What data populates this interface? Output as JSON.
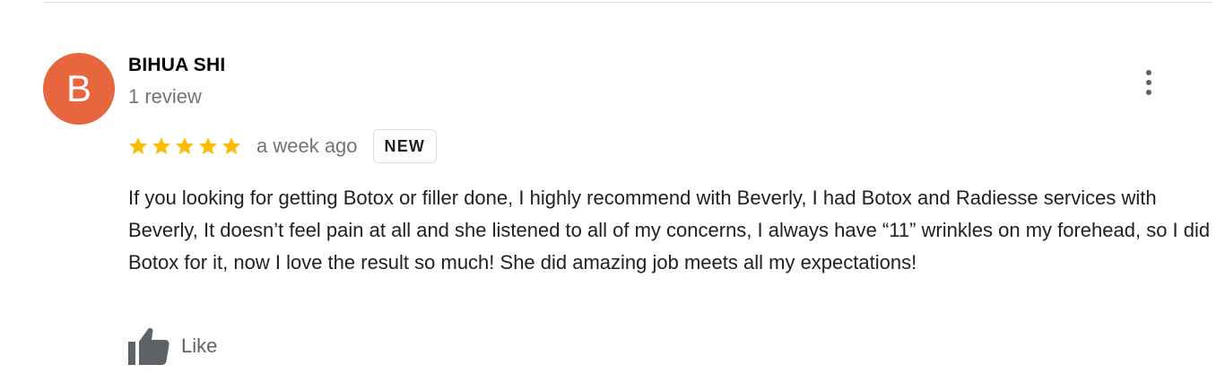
{
  "review": {
    "avatar_letter": "B",
    "author_name": "BIHUA SHI",
    "review_count": "1 review",
    "rating": 5,
    "rating_max": 5,
    "time_ago": "a week ago",
    "badge": "NEW",
    "text": "If you looking for getting Botox or filler done, I highly recommend with Beverly, I had Botox and Radiesse services with Beverly, It doesn’t feel pain at all and she listened to all of my concerns, I always have “11” wrinkles on my forehead, so I did Botox for it, now I love the result so much! She did amazing job meets all my expectations!",
    "like_label": "Like"
  },
  "icons": {
    "more": "more-vert-icon",
    "star": "star-icon",
    "like": "thumbs-up-icon"
  },
  "colors": {
    "avatar_bg": "#e8663d",
    "star": "#fbbc04",
    "secondary_text": "#70757a",
    "icon_gray": "#5f6368",
    "divider": "#e0e0e0"
  }
}
